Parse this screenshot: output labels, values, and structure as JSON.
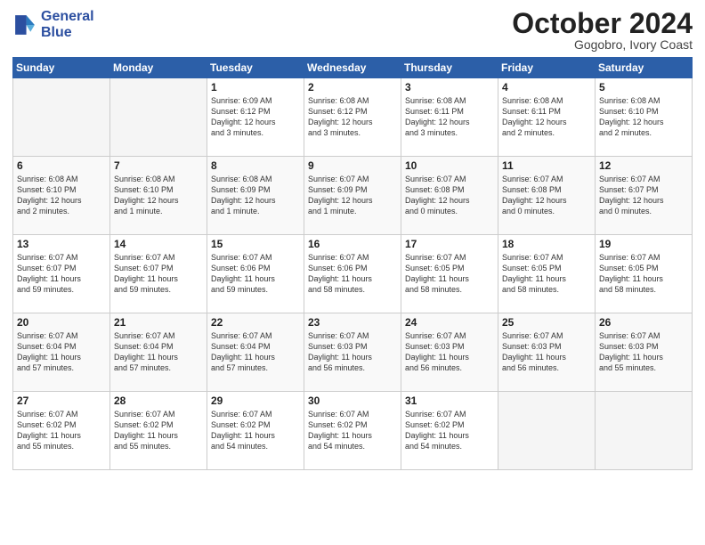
{
  "header": {
    "logo_line1": "General",
    "logo_line2": "Blue",
    "month": "October 2024",
    "location": "Gogobro, Ivory Coast"
  },
  "weekdays": [
    "Sunday",
    "Monday",
    "Tuesday",
    "Wednesday",
    "Thursday",
    "Friday",
    "Saturday"
  ],
  "weeks": [
    [
      {
        "day": "",
        "empty": true
      },
      {
        "day": "",
        "empty": true
      },
      {
        "day": "1",
        "info": "Sunrise: 6:09 AM\nSunset: 6:12 PM\nDaylight: 12 hours\nand 3 minutes."
      },
      {
        "day": "2",
        "info": "Sunrise: 6:08 AM\nSunset: 6:12 PM\nDaylight: 12 hours\nand 3 minutes."
      },
      {
        "day": "3",
        "info": "Sunrise: 6:08 AM\nSunset: 6:11 PM\nDaylight: 12 hours\nand 3 minutes."
      },
      {
        "day": "4",
        "info": "Sunrise: 6:08 AM\nSunset: 6:11 PM\nDaylight: 12 hours\nand 2 minutes."
      },
      {
        "day": "5",
        "info": "Sunrise: 6:08 AM\nSunset: 6:10 PM\nDaylight: 12 hours\nand 2 minutes."
      }
    ],
    [
      {
        "day": "6",
        "info": "Sunrise: 6:08 AM\nSunset: 6:10 PM\nDaylight: 12 hours\nand 2 minutes."
      },
      {
        "day": "7",
        "info": "Sunrise: 6:08 AM\nSunset: 6:10 PM\nDaylight: 12 hours\nand 1 minute."
      },
      {
        "day": "8",
        "info": "Sunrise: 6:08 AM\nSunset: 6:09 PM\nDaylight: 12 hours\nand 1 minute."
      },
      {
        "day": "9",
        "info": "Sunrise: 6:07 AM\nSunset: 6:09 PM\nDaylight: 12 hours\nand 1 minute."
      },
      {
        "day": "10",
        "info": "Sunrise: 6:07 AM\nSunset: 6:08 PM\nDaylight: 12 hours\nand 0 minutes."
      },
      {
        "day": "11",
        "info": "Sunrise: 6:07 AM\nSunset: 6:08 PM\nDaylight: 12 hours\nand 0 minutes."
      },
      {
        "day": "12",
        "info": "Sunrise: 6:07 AM\nSunset: 6:07 PM\nDaylight: 12 hours\nand 0 minutes."
      }
    ],
    [
      {
        "day": "13",
        "info": "Sunrise: 6:07 AM\nSunset: 6:07 PM\nDaylight: 11 hours\nand 59 minutes."
      },
      {
        "day": "14",
        "info": "Sunrise: 6:07 AM\nSunset: 6:07 PM\nDaylight: 11 hours\nand 59 minutes."
      },
      {
        "day": "15",
        "info": "Sunrise: 6:07 AM\nSunset: 6:06 PM\nDaylight: 11 hours\nand 59 minutes."
      },
      {
        "day": "16",
        "info": "Sunrise: 6:07 AM\nSunset: 6:06 PM\nDaylight: 11 hours\nand 58 minutes."
      },
      {
        "day": "17",
        "info": "Sunrise: 6:07 AM\nSunset: 6:05 PM\nDaylight: 11 hours\nand 58 minutes."
      },
      {
        "day": "18",
        "info": "Sunrise: 6:07 AM\nSunset: 6:05 PM\nDaylight: 11 hours\nand 58 minutes."
      },
      {
        "day": "19",
        "info": "Sunrise: 6:07 AM\nSunset: 6:05 PM\nDaylight: 11 hours\nand 58 minutes."
      }
    ],
    [
      {
        "day": "20",
        "info": "Sunrise: 6:07 AM\nSunset: 6:04 PM\nDaylight: 11 hours\nand 57 minutes."
      },
      {
        "day": "21",
        "info": "Sunrise: 6:07 AM\nSunset: 6:04 PM\nDaylight: 11 hours\nand 57 minutes."
      },
      {
        "day": "22",
        "info": "Sunrise: 6:07 AM\nSunset: 6:04 PM\nDaylight: 11 hours\nand 57 minutes."
      },
      {
        "day": "23",
        "info": "Sunrise: 6:07 AM\nSunset: 6:03 PM\nDaylight: 11 hours\nand 56 minutes."
      },
      {
        "day": "24",
        "info": "Sunrise: 6:07 AM\nSunset: 6:03 PM\nDaylight: 11 hours\nand 56 minutes."
      },
      {
        "day": "25",
        "info": "Sunrise: 6:07 AM\nSunset: 6:03 PM\nDaylight: 11 hours\nand 56 minutes."
      },
      {
        "day": "26",
        "info": "Sunrise: 6:07 AM\nSunset: 6:03 PM\nDaylight: 11 hours\nand 55 minutes."
      }
    ],
    [
      {
        "day": "27",
        "info": "Sunrise: 6:07 AM\nSunset: 6:02 PM\nDaylight: 11 hours\nand 55 minutes."
      },
      {
        "day": "28",
        "info": "Sunrise: 6:07 AM\nSunset: 6:02 PM\nDaylight: 11 hours\nand 55 minutes."
      },
      {
        "day": "29",
        "info": "Sunrise: 6:07 AM\nSunset: 6:02 PM\nDaylight: 11 hours\nand 54 minutes."
      },
      {
        "day": "30",
        "info": "Sunrise: 6:07 AM\nSunset: 6:02 PM\nDaylight: 11 hours\nand 54 minutes."
      },
      {
        "day": "31",
        "info": "Sunrise: 6:07 AM\nSunset: 6:02 PM\nDaylight: 11 hours\nand 54 minutes."
      },
      {
        "day": "",
        "empty": true
      },
      {
        "day": "",
        "empty": true
      }
    ]
  ]
}
